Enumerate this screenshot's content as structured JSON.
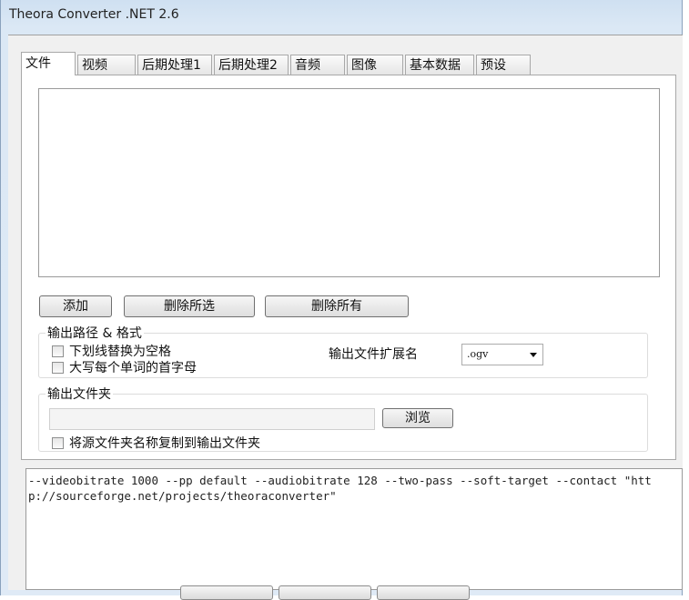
{
  "window": {
    "title": "Theora Converter .NET 2.6"
  },
  "tabs": [
    {
      "label": "文件",
      "active": true
    },
    {
      "label": "视频"
    },
    {
      "label": "后期处理1"
    },
    {
      "label": "后期处理2"
    },
    {
      "label": "音频"
    },
    {
      "label": "图像"
    },
    {
      "label": "基本数据"
    },
    {
      "label": "预设"
    }
  ],
  "file_tab": {
    "buttons": {
      "add": "添加",
      "remove_selected": "删除所选",
      "remove_all": "删除所有"
    },
    "output_path_group": {
      "legend": "输出路径 & 格式",
      "replace_underscores": {
        "label": "下划线替换为空格",
        "checked": false
      },
      "capitalize_words": {
        "label": "大写每个单词的首字母",
        "checked": false
      },
      "extension_label": "输出文件扩展名",
      "extension_value": ".ogv"
    },
    "output_folder_group": {
      "legend": "输出文件夹",
      "folder_value": "",
      "browse_button": "浏览",
      "copy_folder_name": {
        "label": "将源文件夹名称复制到输出文件夹",
        "checked": false
      }
    }
  },
  "command_line": "--videobitrate 1000 --pp default --audiobitrate 128 --two-pass --soft-target --contact \"http://sourceforge.net/projects/theoraconverter\""
}
